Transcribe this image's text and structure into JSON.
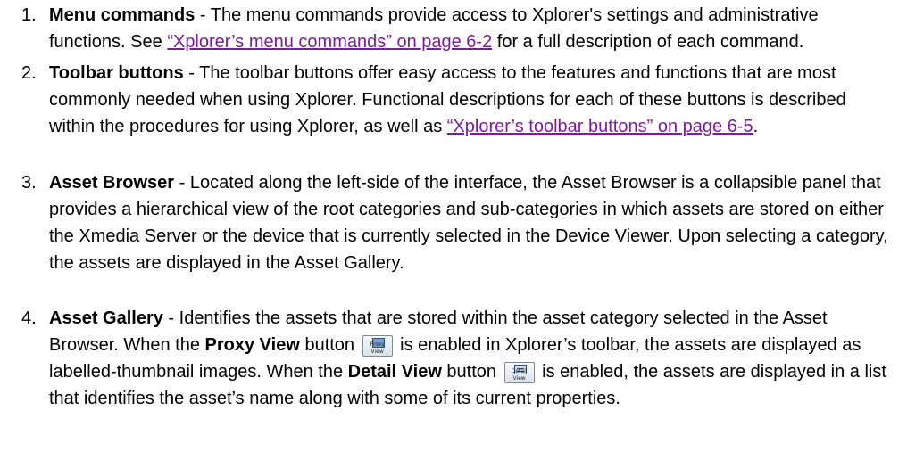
{
  "items": [
    {
      "number": "1.",
      "term": "Menu commands",
      "text_a": " - The menu commands provide access to Xplorer's settings and administrative functions. See ",
      "link": "“Xplorer’s menu commands” on page 6-2",
      "text_b": " for a full description of each command."
    },
    {
      "number": "2.",
      "term": "Toolbar buttons",
      "text_a": " - The toolbar buttons offer easy access to the features and functions that are most commonly needed when using Xplorer. Functional descriptions for each of these buttons is described within the procedures for using Xplorer, as well as ",
      "link": "“Xplorer’s toolbar buttons” on page 6-5",
      "text_b": "."
    },
    {
      "number": "3.",
      "term": "Asset Browser",
      "text_a": " - Located along the left-side of the interface, the Asset Browser is a collapsible panel that provides a hierarchical view of the root categories and sub-categories in which assets are stored on either the Xmedia Server or the device that is currently selected in the Device Viewer. Upon selecting a category, the assets are displayed in the Asset Gallery."
    },
    {
      "number": "4.",
      "term": "Asset Gallery",
      "text_a": " - Identifies the assets that are stored within the asset category selected in the Asset Browser. When the ",
      "proxy_label": "Proxy View",
      "text_b": " button ",
      "proxy_icon_caption": "Proxy View",
      "text_c": " is enabled in Xplorer’s toolbar, the assets are displayed as labelled-thumbnail images. When the ",
      "detail_label": "Detail View",
      "text_d": " button ",
      "detail_icon_caption": "Detail View",
      "text_e": " is enabled, the assets are displayed in a list that identifies the asset’s name along with some of its current properties."
    }
  ]
}
